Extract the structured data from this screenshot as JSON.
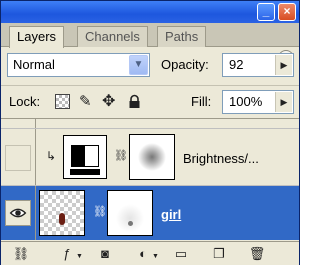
{
  "window": {
    "min_glyph": "_",
    "close_glyph": "×"
  },
  "tabs": [
    {
      "label": "Layers",
      "active": true
    },
    {
      "label": "Channels",
      "active": false
    },
    {
      "label": "Paths",
      "active": false
    }
  ],
  "blend_mode": {
    "value": "Normal"
  },
  "opacity": {
    "label": "Opacity:",
    "value": "92"
  },
  "lock": {
    "label": "Lock:"
  },
  "fill": {
    "label": "Fill:",
    "value": "100%"
  },
  "layers": [
    {
      "name": "Brightness/...",
      "visible": false,
      "selected": false,
      "type": "adjustment"
    },
    {
      "name": "girl",
      "visible": true,
      "selected": true,
      "type": "image"
    }
  ],
  "icons": {
    "eye": "eye-icon",
    "chain": "link-icon",
    "clip_arrow": "clipping-arrow-icon"
  },
  "colors": {
    "selection": "#3169c6",
    "panel": "#ece9d8",
    "titlebar": "#1d57de"
  }
}
